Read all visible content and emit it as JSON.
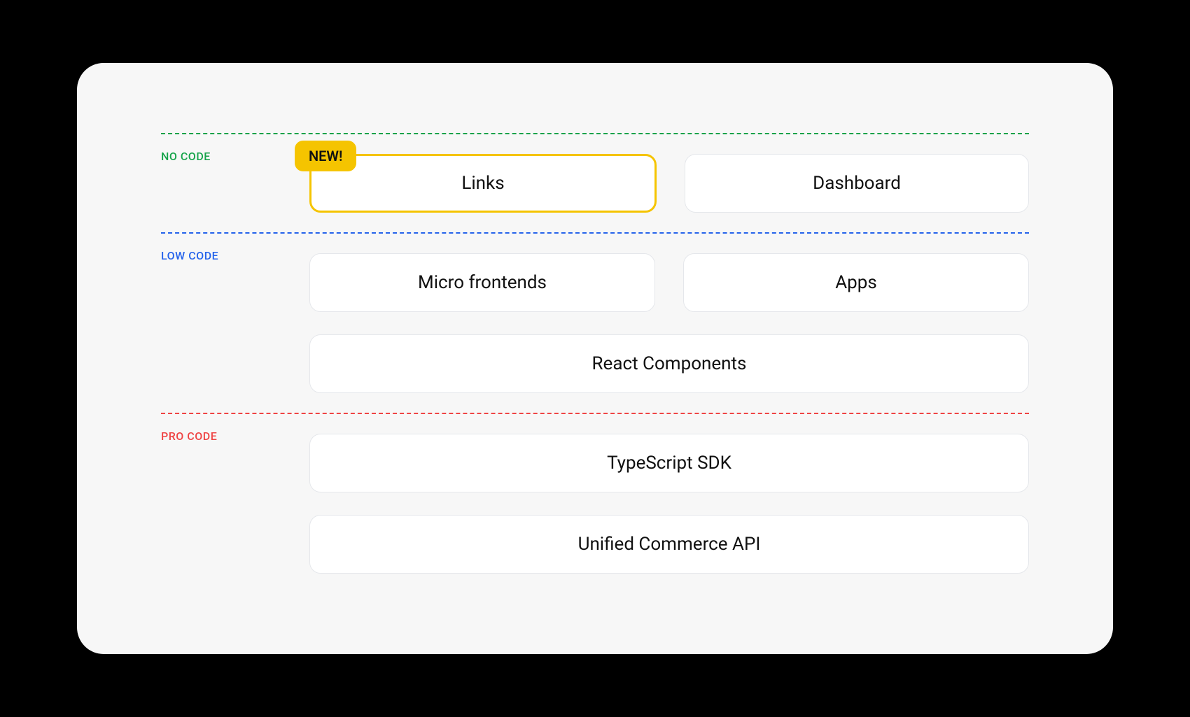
{
  "tiers": [
    {
      "key": "no_code",
      "label": "NO CODE",
      "color": "green",
      "rows": [
        [
          {
            "key": "links",
            "label": "Links",
            "highlight": true,
            "badge": "NEW!"
          },
          {
            "key": "dashboard",
            "label": "Dashboard"
          }
        ]
      ]
    },
    {
      "key": "low_code",
      "label": "LOW CODE",
      "color": "blue",
      "rows": [
        [
          {
            "key": "micro_frontends",
            "label": "Micro frontends"
          },
          {
            "key": "apps",
            "label": "Apps"
          }
        ],
        [
          {
            "key": "react_components",
            "label": "React Components"
          }
        ]
      ]
    },
    {
      "key": "pro_code",
      "label": "PRO CODE",
      "color": "red",
      "rows": [
        [
          {
            "key": "typescript_sdk",
            "label": "TypeScript SDK"
          }
        ],
        [
          {
            "key": "unified_commerce_api",
            "label": "Unified Commerce API"
          }
        ]
      ]
    }
  ]
}
